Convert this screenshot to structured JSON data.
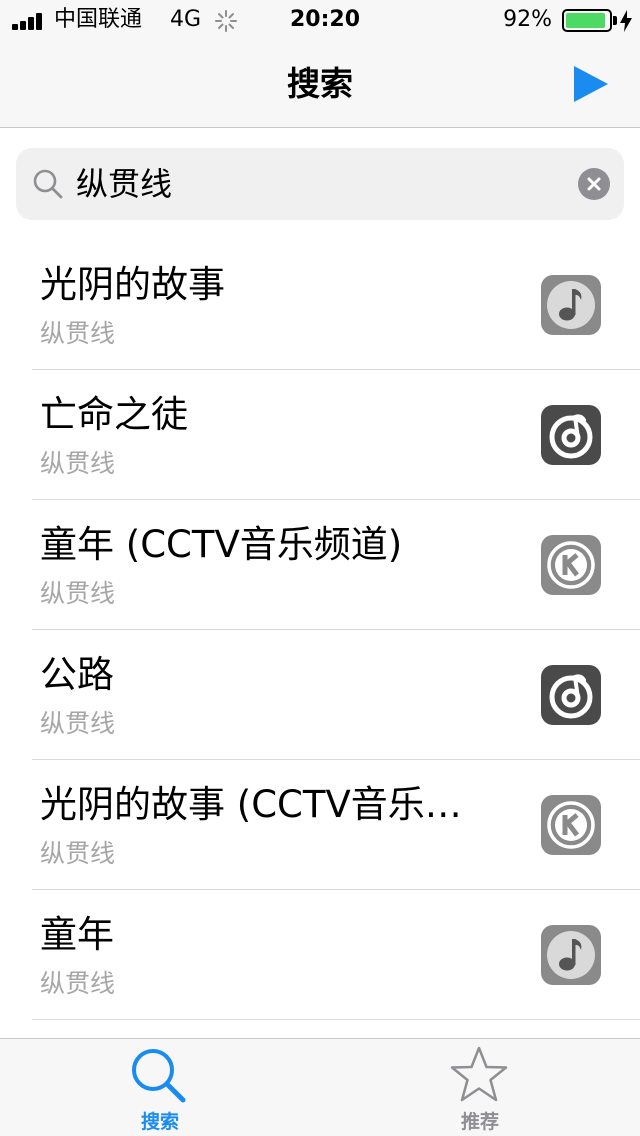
{
  "status_bar": {
    "carrier": "中国联通",
    "network": "4G",
    "time": "20:20",
    "battery_percent": "92%",
    "battery_level": 0.92,
    "battery_color": "#4cd964"
  },
  "nav": {
    "title": "搜索",
    "right_icon": "play-icon",
    "accent_color": "#1a8cf0"
  },
  "search": {
    "value": "纵贯线",
    "left_icon": "search-icon",
    "clear_icon": "clear-icon"
  },
  "results": [
    {
      "title": "光阴的故事",
      "artist": "纵贯线",
      "source_icon": "music-note-app-icon"
    },
    {
      "title": "亡命之徒",
      "artist": "纵贯线",
      "source_icon": "netease-music-app-icon"
    },
    {
      "title": "童年 (CCTV音乐频道)",
      "artist": "纵贯线",
      "source_icon": "kugou-app-icon"
    },
    {
      "title": "公路",
      "artist": "纵贯线",
      "source_icon": "netease-music-app-icon"
    },
    {
      "title": "光阴的故事 (CCTV音乐…",
      "artist": "纵贯线",
      "source_icon": "kugou-app-icon"
    },
    {
      "title": "童年",
      "artist": "纵贯线",
      "source_icon": "music-note-app-icon"
    }
  ],
  "tab_bar": {
    "tabs": [
      {
        "label": "搜索",
        "icon": "search-icon",
        "active": true,
        "color": "#1a8cf0"
      },
      {
        "label": "推荐",
        "icon": "star-icon",
        "active": false,
        "color": "#8e8e93"
      }
    ]
  }
}
